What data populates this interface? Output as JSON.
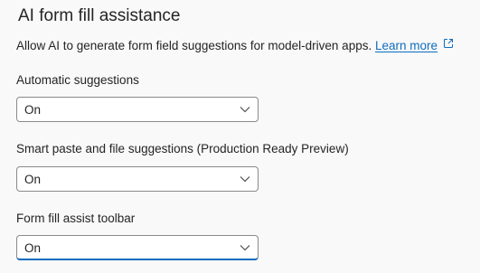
{
  "section": {
    "title": "AI form fill assistance",
    "description": "Allow AI to generate form field suggestions for model-driven apps.",
    "learn_more_label": "Learn more",
    "learn_more_icon": "external-link-icon"
  },
  "settings": [
    {
      "label": "Automatic suggestions",
      "value": "On",
      "icon": "chevron-down-icon"
    },
    {
      "label": "Smart paste and file suggestions (Production Ready Preview)",
      "value": "On",
      "icon": "chevron-down-icon"
    },
    {
      "label": "Form fill assist toolbar",
      "value": "On",
      "icon": "chevron-down-icon"
    }
  ],
  "colors": {
    "background": "#f9f9f9",
    "text": "#242424",
    "link": "#0f6cbd",
    "border": "#8a8a8a",
    "focus_underline": "#0f6cbd"
  }
}
